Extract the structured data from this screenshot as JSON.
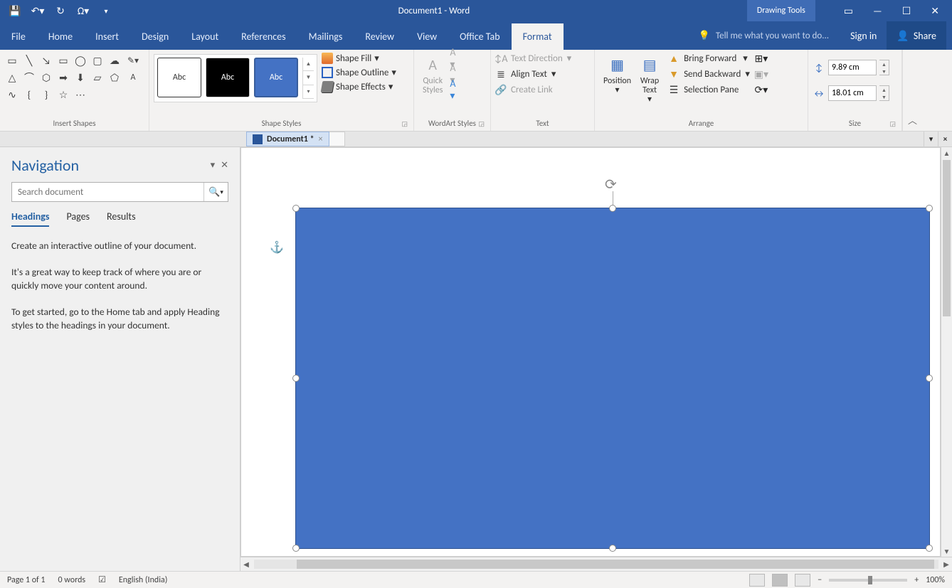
{
  "window": {
    "title": "Document1 - Word",
    "context_tab": "Drawing Tools",
    "signin": "Sign in",
    "share": "Share"
  },
  "ribbon": {
    "tabs": [
      "File",
      "Home",
      "Insert",
      "Design",
      "Layout",
      "References",
      "Mailings",
      "Review",
      "View",
      "Office Tab",
      "Format"
    ],
    "active_tab": "Format",
    "tellme_placeholder": "Tell me what you want to do...",
    "groups": {
      "insert_shapes": "Insert Shapes",
      "shape_styles": "Shape Styles",
      "wordart_styles": "WordArt Styles",
      "text": "Text",
      "arrange": "Arrange",
      "size": "Size"
    },
    "shape_fill": "Shape Fill",
    "shape_outline": "Shape Outline",
    "shape_effects": "Shape Effects",
    "quick_styles": "Quick\nStyles",
    "text_direction": "Text Direction",
    "align_text": "Align Text",
    "create_link": "Create Link",
    "position": "Position",
    "wrap_text": "Wrap\nText",
    "bring_forward": "Bring Forward",
    "send_backward": "Send Backward",
    "selection_pane": "Selection Pane",
    "size_height": "9.89 cm",
    "size_width": "18.01 cm",
    "swatch_label": "Abc"
  },
  "doctab": {
    "name": "Document1 *"
  },
  "navigation": {
    "title": "Navigation",
    "search_placeholder": "Search document",
    "tabs": [
      "Headings",
      "Pages",
      "Results"
    ],
    "active_tab": "Headings",
    "para1": "Create an interactive outline of your document.",
    "para2": "It's a great way to keep track of where you are or quickly move your content around.",
    "para3": "To get started, go to the Home tab and apply Heading styles to the headings in your document."
  },
  "statusbar": {
    "page": "Page 1 of 1",
    "words": "0 words",
    "language": "English (India)",
    "zoom": "100%"
  }
}
